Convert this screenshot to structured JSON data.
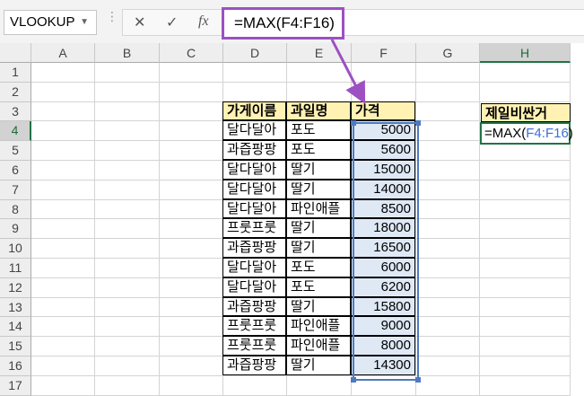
{
  "name_box": {
    "value": "VLOOKUP"
  },
  "formula_bar": {
    "cancel_icon": "✕",
    "enter_icon": "✓",
    "fx_icon": "fx",
    "formula": "=MAX(F4:F16)"
  },
  "columns": [
    "A",
    "B",
    "C",
    "D",
    "E",
    "F",
    "G",
    "H"
  ],
  "rows": [
    "1",
    "2",
    "3",
    "4",
    "5",
    "6",
    "7",
    "8",
    "9",
    "10",
    "11",
    "12",
    "13",
    "14",
    "15",
    "16",
    "17"
  ],
  "table": {
    "headers": [
      "가게이름",
      "과일명",
      "가격"
    ],
    "rows": [
      [
        "달다달아",
        "포도",
        "5000"
      ],
      [
        "과즙팡팡",
        "포도",
        "5600"
      ],
      [
        "달다달아",
        "딸기",
        "15000"
      ],
      [
        "달다달아",
        "딸기",
        "14000"
      ],
      [
        "달다달아",
        "파인애플",
        "8500"
      ],
      [
        "프룻프룻",
        "딸기",
        "18000"
      ],
      [
        "과즙팡팡",
        "딸기",
        "16500"
      ],
      [
        "달다달아",
        "포도",
        "6000"
      ],
      [
        "달다달아",
        "포도",
        "6200"
      ],
      [
        "과즙팡팡",
        "딸기",
        "15800"
      ],
      [
        "프룻프룻",
        "파인애플",
        "9000"
      ],
      [
        "프룻프룻",
        "파인애플",
        "8000"
      ],
      [
        "과즙팡팡",
        "딸기",
        "14300"
      ]
    ]
  },
  "result": {
    "label": "제일비싼거",
    "cell_prefix": "=MAX(",
    "cell_ref": "F4:F16",
    "cell_suffix": ")"
  },
  "colors": {
    "accent": "#217346",
    "highlight": "#9c50c2",
    "range": "#4f79c1",
    "header_fill": "#fff2b3"
  },
  "icons": [
    "dropdown-arrow-icon",
    "cancel-icon",
    "enter-icon",
    "fx-icon",
    "callout-arrow-icon"
  ]
}
